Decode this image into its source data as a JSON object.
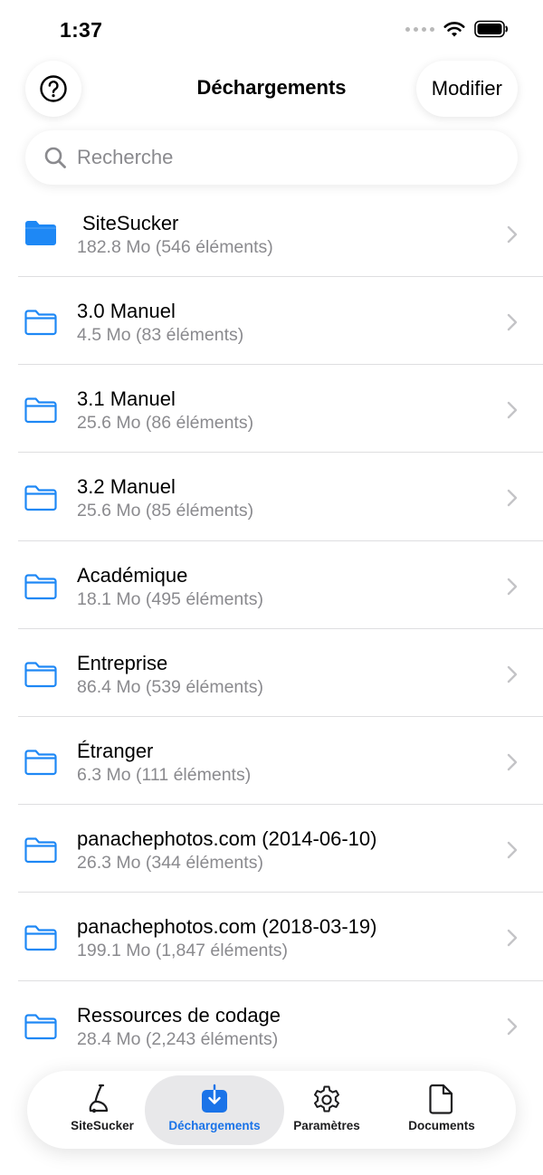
{
  "status_bar": {
    "time": "1:37"
  },
  "header": {
    "title": "Déchargements",
    "edit_label": "Modifier"
  },
  "search": {
    "placeholder": "Recherche"
  },
  "colors": {
    "accent": "#1a73e8",
    "secondary_text": "#8a8a8e"
  },
  "folders": [
    {
      "name": "SiteSucker",
      "meta": "182.8 Mo (546 éléments)",
      "icon": "folder-filled-icon"
    },
    {
      "name": "3.0 Manuel",
      "meta": "4.5 Mo (83 éléments)",
      "icon": "folder-outline-icon"
    },
    {
      "name": "3.1 Manuel",
      "meta": "25.6 Mo (86 éléments)",
      "icon": "folder-outline-icon"
    },
    {
      "name": "3.2 Manuel",
      "meta": "25.6 Mo (85 éléments)",
      "icon": "folder-outline-icon"
    },
    {
      "name": "Académique",
      "meta": "18.1 Mo (495 éléments)",
      "icon": "folder-outline-icon"
    },
    {
      "name": "Entreprise",
      "meta": "86.4 Mo (539 éléments)",
      "icon": "folder-outline-icon"
    },
    {
      "name": "Étranger",
      "meta": "6.3 Mo (111 éléments)",
      "icon": "folder-outline-icon"
    },
    {
      "name": "panachephotos.com (2014-06-10)",
      "meta": "26.3 Mo (344 éléments)",
      "icon": "folder-outline-icon"
    },
    {
      "name": "panachephotos.com (2018-03-19)",
      "meta": "199.1 Mo (1,847 éléments)",
      "icon": "folder-outline-icon"
    },
    {
      "name": "Ressources de codage",
      "meta": "28.4 Mo (2,243 éléments)",
      "icon": "folder-outline-icon"
    }
  ],
  "tabs": [
    {
      "label": "SiteSucker",
      "icon": "vacuum-icon",
      "active": false
    },
    {
      "label": "Déchargements",
      "icon": "download-icon",
      "active": true
    },
    {
      "label": "Paramètres",
      "icon": "gear-icon",
      "active": false
    },
    {
      "label": "Documents",
      "icon": "document-icon",
      "active": false
    }
  ]
}
